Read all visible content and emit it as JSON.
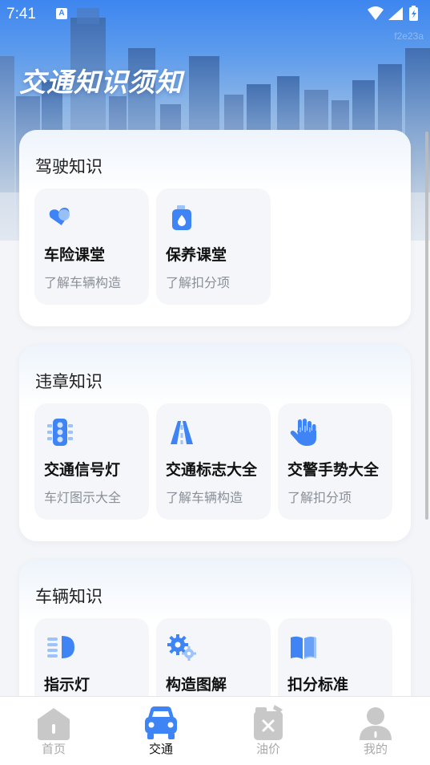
{
  "status_bar": {
    "time": "7:41",
    "a_badge": "A",
    "watermark": "f2e23a"
  },
  "header": {
    "title": "交通知识须知"
  },
  "colors": {
    "accent": "#3f84f5",
    "icon_light": "#9cc3fb",
    "inactive": "#bdbdbd"
  },
  "sections": [
    {
      "title": "驾驶知识",
      "items": [
        {
          "icon": "heart-shield-icon",
          "title": "车险课堂",
          "subtitle": "了解车辆构造"
        },
        {
          "icon": "bottle-drop-icon",
          "title": "保养课堂",
          "subtitle": "了解扣分项"
        }
      ]
    },
    {
      "title": "违章知识",
      "items": [
        {
          "icon": "traffic-light-icon",
          "title": "交通信号灯",
          "subtitle": "车灯图示大全"
        },
        {
          "icon": "road-icon",
          "title": "交通标志大全",
          "subtitle": "了解车辆构造"
        },
        {
          "icon": "hand-icon",
          "title": "交警手势大全",
          "subtitle": "了解扣分项"
        }
      ]
    },
    {
      "title": "车辆知识",
      "items": [
        {
          "icon": "headlight-icon",
          "title": "指示灯",
          "subtitle": ""
        },
        {
          "icon": "gears-icon",
          "title": "构造图解",
          "subtitle": ""
        },
        {
          "icon": "book-icon",
          "title": "扣分标准",
          "subtitle": ""
        }
      ]
    }
  ],
  "bottom_nav": {
    "items": [
      {
        "label": "首页",
        "icon": "home-icon",
        "active": false
      },
      {
        "label": "交通",
        "icon": "car-icon",
        "active": true
      },
      {
        "label": "油价",
        "icon": "fuel-can-icon",
        "active": false
      },
      {
        "label": "我的",
        "icon": "user-icon",
        "active": false
      }
    ]
  }
}
